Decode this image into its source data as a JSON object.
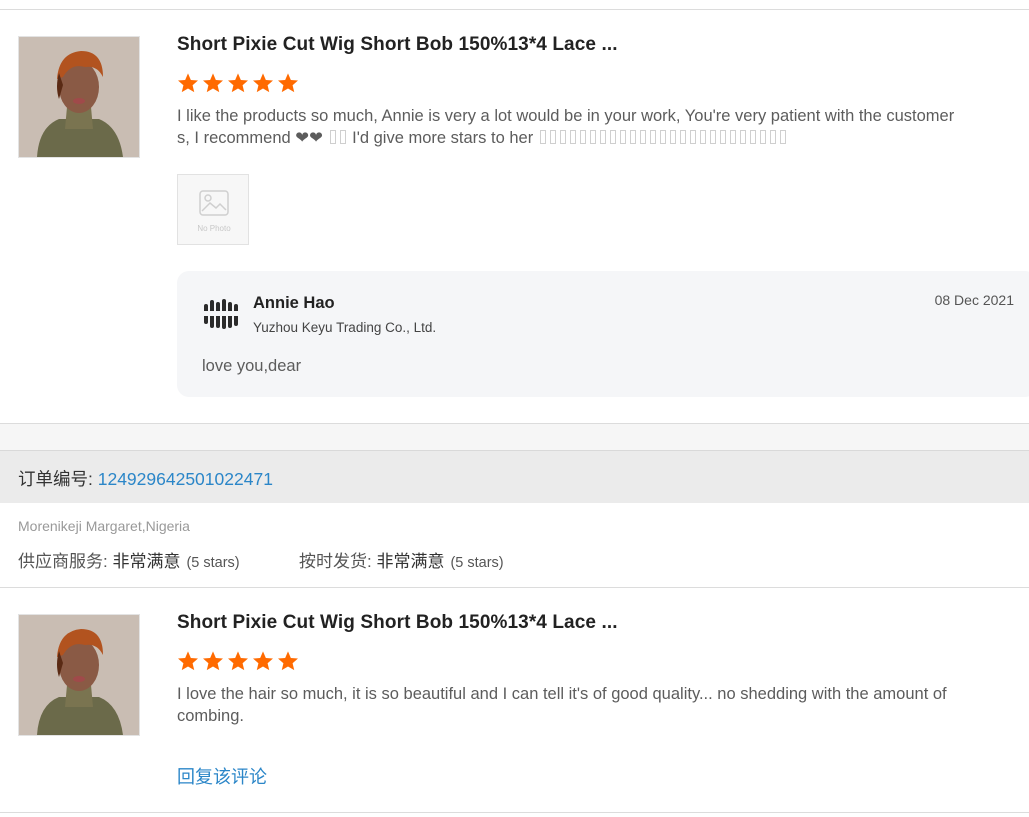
{
  "review1": {
    "product_title": "Short Pixie Cut Wig Short Bob 150%13*4 Lace ...",
    "rating": 5,
    "text_line1": "I like the products so much, Annie is very a lot would be in your work, You're very patient with the customer",
    "text_line2_a": "s, I recommend ❤❤",
    "text_line2_b": "I'd give more stars to her",
    "no_photo_label": "No Photo",
    "seller_reply": {
      "name": "Annie Hao",
      "company": "Yuzhou Keyu Trading Co., Ltd.",
      "date": "08 Dec 2021",
      "text": "love you,dear"
    }
  },
  "order": {
    "label": "订单编号: ",
    "number": "124929642501022471"
  },
  "review2": {
    "buyer": "Morenikeji Margaret,Nigeria",
    "supplier_service_label": "供应商服务: ",
    "supplier_service_value": "非常满意",
    "supplier_service_stars": "(5 stars)",
    "shipping_label": "按时发货: ",
    "shipping_value": "非常满意",
    "shipping_stars": "(5 stars)",
    "product_title": "Short Pixie Cut Wig Short Bob 150%13*4 Lace ...",
    "rating": 5,
    "text": "I love the hair so much, it is so beautiful and I can tell it's of good quality... no shedding with the amount of combing.",
    "reply_link": "回复该评论"
  },
  "colors": {
    "star": "#ff6a00",
    "link": "#2b86c8",
    "reply_bg": "#f5f6f8",
    "order_bar": "#ebebeb"
  }
}
